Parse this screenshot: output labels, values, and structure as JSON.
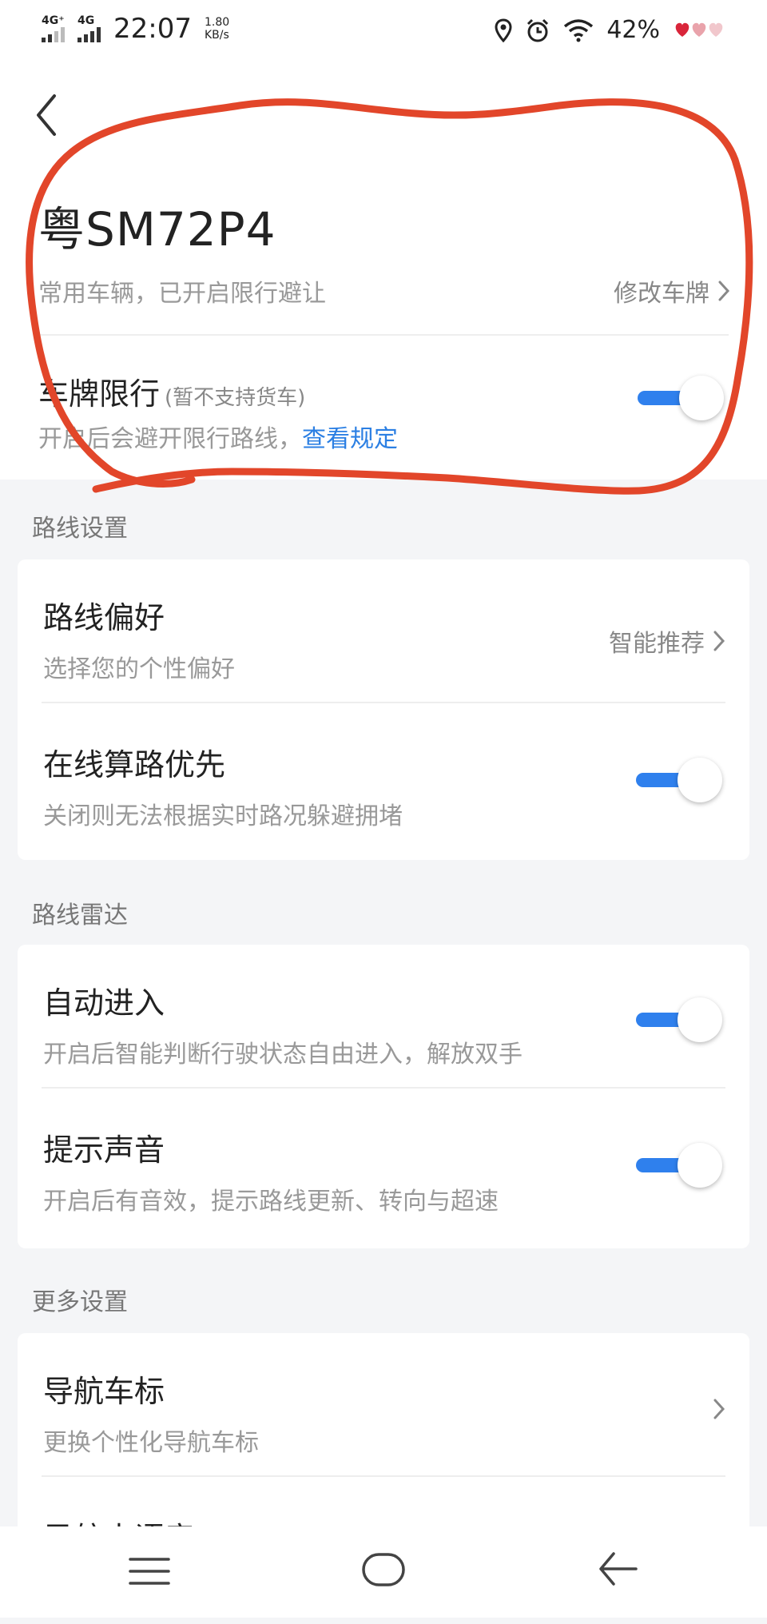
{
  "status_bar": {
    "network1": "4G⁺",
    "network2": "4G",
    "time": "22:07",
    "speed_value": "1.80",
    "speed_unit": "KB/s",
    "battery": "42%"
  },
  "vehicle": {
    "plate": "粤SM72P4",
    "subtitle": "常用车辆，已开启限行避让",
    "edit_label": "修改车牌"
  },
  "restriction": {
    "title": "车牌限行",
    "note": "(暂不支持货车)",
    "desc": "开启后会避开限行路线，",
    "link": "查看规定",
    "enabled": true
  },
  "route_settings": {
    "label": "路线设置",
    "items": [
      {
        "title": "路线偏好",
        "subtitle": "选择您的个性偏好",
        "value": "智能推荐"
      },
      {
        "title": "在线算路优先",
        "subtitle": "关闭则无法根据实时路况躲避拥堵",
        "enabled": true
      }
    ]
  },
  "route_radar": {
    "label": "路线雷达",
    "items": [
      {
        "title": "自动进入",
        "subtitle": "开启后智能判断行驶状态自由进入，解放双手",
        "enabled": true
      },
      {
        "title": "提示声音",
        "subtitle": "开启后有音效，提示路线更新、转向与超速",
        "enabled": true
      }
    ]
  },
  "more_settings": {
    "label": "更多设置",
    "items": [
      {
        "title": "导航车标",
        "subtitle": "更换个性化导航车标"
      },
      {
        "title": "导航中语音"
      }
    ]
  },
  "colors": {
    "accent": "#2f80ed",
    "link": "#2b7fe3",
    "annotation": "#e2462a"
  }
}
